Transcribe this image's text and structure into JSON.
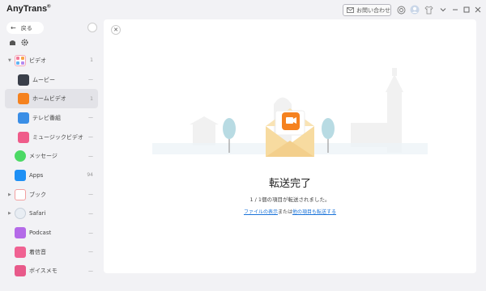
{
  "app": {
    "title": "AnyTrans",
    "reg_mark": "®"
  },
  "titlebar": {
    "contact_label": "お問い合わせ"
  },
  "sidebar": {
    "back_label": "戻る",
    "items": [
      {
        "label": "ビデオ",
        "count": "1",
        "level": "top",
        "expander": "▼"
      },
      {
        "label": "ムービー",
        "count": "—",
        "level": "sub"
      },
      {
        "label": "ホームビデオ",
        "count": "1",
        "level": "sub",
        "active": true
      },
      {
        "label": "テレビ番組",
        "count": "—",
        "level": "sub"
      },
      {
        "label": "ミュージックビデオ",
        "count": "—",
        "level": "sub"
      },
      {
        "label": "メッセージ",
        "count": "—",
        "level": "top"
      },
      {
        "label": "Apps",
        "count": "94",
        "level": "top"
      },
      {
        "label": "ブック",
        "count": "—",
        "level": "top",
        "expander": "▶"
      },
      {
        "label": "Safari",
        "count": "—",
        "level": "top",
        "expander": "▶"
      },
      {
        "label": "Podcast",
        "count": "—",
        "level": "top"
      },
      {
        "label": "着信音",
        "count": "—",
        "level": "top"
      },
      {
        "label": "ボイスメモ",
        "count": "—",
        "level": "top"
      }
    ]
  },
  "main": {
    "close_symbol": "✕",
    "done_title": "転送完了",
    "done_message": "1 / 1個の項目が転送されました。",
    "link_view_file": "ファイルの表示",
    "link_connector": "または",
    "link_transfer_other": "他の項目も転送する"
  },
  "colors": {
    "accent_orange": "#f5821f",
    "link_blue": "#1a73d9",
    "sidebar_bg": "#f2f2f5"
  }
}
